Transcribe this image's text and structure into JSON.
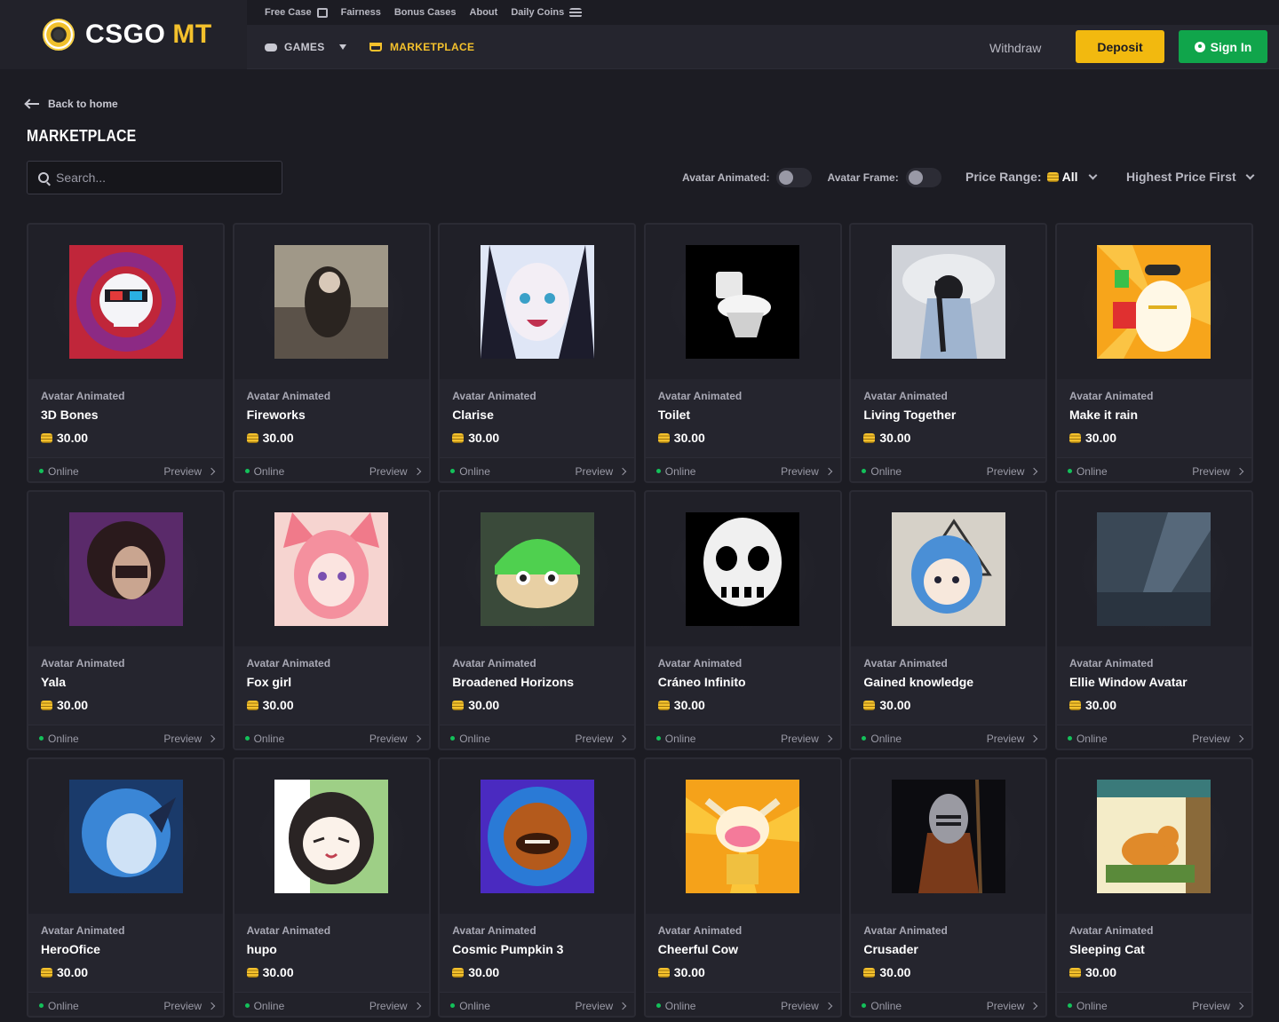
{
  "brand": {
    "name": "CSGO",
    "accent": "MT"
  },
  "topstrip": [
    {
      "label": "Free Case",
      "icon": "gift-icon"
    },
    {
      "label": "Fairness",
      "icon": ""
    },
    {
      "label": "Bonus Cases",
      "icon": ""
    },
    {
      "label": "About",
      "icon": ""
    },
    {
      "label": "Daily Coins",
      "icon": "coins-icon"
    }
  ],
  "nav": {
    "games": "GAMES",
    "marketplace": "MARKETPLACE"
  },
  "header": {
    "withdraw": "Withdraw",
    "deposit": "Deposit",
    "signin": "Sign In"
  },
  "page": {
    "back": "Back to home",
    "title": "MARKETPLACE"
  },
  "search": {
    "placeholder": "Search..."
  },
  "filters": {
    "avatar_animated": "Avatar Animated:",
    "avatar_frame": "Avatar Frame:",
    "price_range_label": "Price Range:",
    "price_range_value": "All",
    "sort": "Highest Price First"
  },
  "colors": {
    "accent": "#f4c12c",
    "deposit": "#f2b90f",
    "signin": "#10a54b",
    "online": "#13c15a"
  },
  "items": [
    {
      "type": "Avatar Animated",
      "name": "3D Bones",
      "price": "30.00",
      "status": "Online",
      "preview": "Preview"
    },
    {
      "type": "Avatar Animated",
      "name": "Fireworks",
      "price": "30.00",
      "status": "Online",
      "preview": "Preview"
    },
    {
      "type": "Avatar Animated",
      "name": "Clarise",
      "price": "30.00",
      "status": "Online",
      "preview": "Preview"
    },
    {
      "type": "Avatar Animated",
      "name": "Toilet",
      "price": "30.00",
      "status": "Online",
      "preview": "Preview"
    },
    {
      "type": "Avatar Animated",
      "name": "Living Together",
      "price": "30.00",
      "status": "Online",
      "preview": "Preview"
    },
    {
      "type": "Avatar Animated",
      "name": "Make it rain",
      "price": "30.00",
      "status": "Online",
      "preview": "Preview"
    },
    {
      "type": "Avatar Animated",
      "name": "Yala",
      "price": "30.00",
      "status": "Online",
      "preview": "Preview"
    },
    {
      "type": "Avatar Animated",
      "name": "Fox girl",
      "price": "30.00",
      "status": "Online",
      "preview": "Preview"
    },
    {
      "type": "Avatar Animated",
      "name": "Broadened Horizons",
      "price": "30.00",
      "status": "Online",
      "preview": "Preview"
    },
    {
      "type": "Avatar Animated",
      "name": "Cráneo Infinito",
      "price": "30.00",
      "status": "Online",
      "preview": "Preview"
    },
    {
      "type": "Avatar Animated",
      "name": "Gained knowledge",
      "price": "30.00",
      "status": "Online",
      "preview": "Preview"
    },
    {
      "type": "Avatar Animated",
      "name": "Ellie Window Avatar",
      "price": "30.00",
      "status": "Online",
      "preview": "Preview"
    },
    {
      "type": "Avatar Animated",
      "name": "HeroOfice",
      "price": "30.00",
      "status": "Online",
      "preview": "Preview"
    },
    {
      "type": "Avatar Animated",
      "name": "hupo",
      "price": "30.00",
      "status": "Online",
      "preview": "Preview"
    },
    {
      "type": "Avatar Animated",
      "name": "Cosmic Pumpkin 3",
      "price": "30.00",
      "status": "Online",
      "preview": "Preview"
    },
    {
      "type": "Avatar Animated",
      "name": "Cheerful Cow",
      "price": "30.00",
      "status": "Online",
      "preview": "Preview"
    },
    {
      "type": "Avatar Animated",
      "name": "Crusader",
      "price": "30.00",
      "status": "Online",
      "preview": "Preview"
    },
    {
      "type": "Avatar Animated",
      "name": "Sleeping Cat",
      "price": "30.00",
      "status": "Online",
      "preview": "Preview"
    }
  ]
}
